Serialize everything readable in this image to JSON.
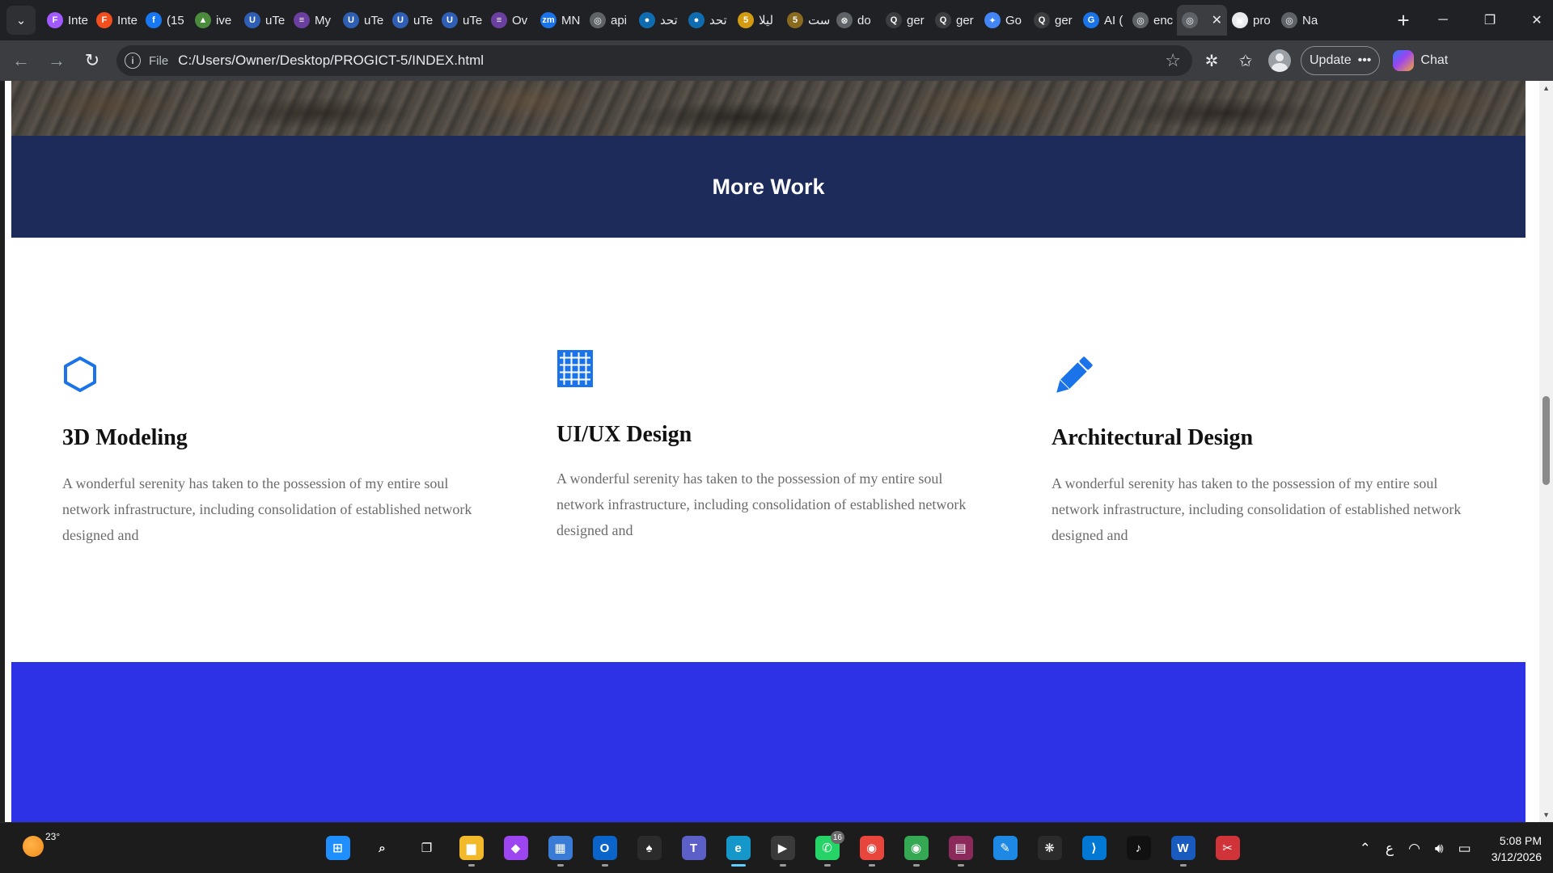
{
  "browser": {
    "tabs": [
      {
        "title": "Inte",
        "fav": "F",
        "color": "#a259ff"
      },
      {
        "title": "Inte",
        "fav": "F",
        "color": "#f24e1e"
      },
      {
        "title": "(15",
        "fav": "f",
        "color": "#1877f2"
      },
      {
        "title": "ive",
        "fav": "▲",
        "color": "#4a8b3c"
      },
      {
        "title": "uTe",
        "fav": "U",
        "color": "#2f5fb4"
      },
      {
        "title": "My",
        "fav": "≡",
        "color": "#6b3fa0"
      },
      {
        "title": "uTe",
        "fav": "U",
        "color": "#2f5fb4"
      },
      {
        "title": "uTe",
        "fav": "U",
        "color": "#2f5fb4"
      },
      {
        "title": "uTe",
        "fav": "U",
        "color": "#2f5fb4"
      },
      {
        "title": "Ov",
        "fav": "≡",
        "color": "#6b3fa0"
      },
      {
        "title": "MN",
        "fav": "zm",
        "color": "#1a73e8"
      },
      {
        "title": "api",
        "fav": "◎",
        "color": "#5f6368"
      },
      {
        "title": "تحد",
        "fav": "●",
        "color": "#0f6cb0"
      },
      {
        "title": "تحد",
        "fav": "●",
        "color": "#0f6cb0"
      },
      {
        "title": "ليلا",
        "fav": "5",
        "color": "#d29b12"
      },
      {
        "title": "است",
        "fav": "5",
        "color": "#8a6a1e"
      },
      {
        "title": "do",
        "fav": "⊗",
        "color": "#5f6368"
      },
      {
        "title": "ger",
        "fav": "Q",
        "color": "#3c3d40"
      },
      {
        "title": "ger",
        "fav": "Q",
        "color": "#3c3d40"
      },
      {
        "title": "Go",
        "fav": "✦",
        "color": "#4285f4"
      },
      {
        "title": "ger",
        "fav": "Q",
        "color": "#3c3d40"
      },
      {
        "title": "AI (",
        "fav": "G",
        "color": "#1a73e8"
      },
      {
        "title": "enc",
        "fav": "◎",
        "color": "#5f6368"
      },
      {
        "title": "",
        "fav": "◎",
        "color": "#5f6368",
        "active": true
      },
      {
        "title": "pro",
        "fav": "▣",
        "color": "#e8eaed"
      },
      {
        "title": "Na",
        "fav": "◎",
        "color": "#5f6368"
      }
    ],
    "omnibox": {
      "scheme": "File",
      "url": "C:/Users/Owner/Desktop/PROGICT-5/INDEX.html"
    },
    "update_label": "Update",
    "chat_label": "Chat"
  },
  "page": {
    "section_title": "More Work",
    "services": [
      {
        "title": "3D Modeling",
        "icon": "hexagon-icon",
        "text": "A wonderful serenity has taken to the possession of my entire soul network infrastructure, including consolidation of established network designed and"
      },
      {
        "title": "UI/UX Design",
        "icon": "grid-icon",
        "text": "A wonderful serenity has taken to the possession of my entire soul network infrastructure, including consolidation of established network designed and"
      },
      {
        "title": "Architectural Design",
        "icon": "pencil-icon",
        "text": "A wonderful serenity has taken to the possession of my entire soul network infrastructure, including consolidation of established network designed and"
      }
    ],
    "colors": {
      "header_band": "#1c2b5a",
      "accent_icon": "#1a73e8",
      "bottom_band": "#2d32e6"
    }
  },
  "taskbar": {
    "weather_temp": "23°",
    "apps": [
      {
        "name": "start",
        "glyph": "⊞",
        "color": "#1f8fff"
      },
      {
        "name": "search",
        "glyph": "⌕",
        "color": "transparent"
      },
      {
        "name": "task-view",
        "glyph": "❐",
        "color": "transparent"
      },
      {
        "name": "file-explorer",
        "glyph": "▆",
        "color": "#f2b92a"
      },
      {
        "name": "copilot",
        "glyph": "◆",
        "color": "#9c45f0"
      },
      {
        "name": "store",
        "glyph": "▦",
        "color": "#3a7bd5"
      },
      {
        "name": "outlook",
        "glyph": "O",
        "color": "#0a64c9"
      },
      {
        "name": "solitaire",
        "glyph": "♠",
        "color": "#2b2b2b"
      },
      {
        "name": "teams",
        "glyph": "T",
        "color": "#5b5fc7"
      },
      {
        "name": "edge",
        "glyph": "e",
        "color": "#1597c9"
      },
      {
        "name": "media-player",
        "glyph": "▶",
        "color": "#3a3a3a"
      },
      {
        "name": "whatsapp",
        "glyph": "✆",
        "color": "#25d366",
        "badge": "16"
      },
      {
        "name": "chrome-k",
        "glyph": "◉",
        "color": "#e8453c"
      },
      {
        "name": "chrome-m",
        "glyph": "◉",
        "color": "#34a853"
      },
      {
        "name": "winrar",
        "glyph": "▤",
        "color": "#8b2a5a"
      },
      {
        "name": "paint",
        "glyph": "✎",
        "color": "#1e88e5"
      },
      {
        "name": "chatgpt",
        "glyph": "❋",
        "color": "#2b2b2b"
      },
      {
        "name": "vscode",
        "glyph": "⟩",
        "color": "#0078d4"
      },
      {
        "name": "tiktok",
        "glyph": "♪",
        "color": "#111111"
      },
      {
        "name": "word",
        "glyph": "W",
        "color": "#185abd"
      },
      {
        "name": "snipping",
        "glyph": "✂",
        "color": "#d13438"
      }
    ],
    "tray_lang": "ع",
    "time": "5:08 PM",
    "date": "3/12/2026"
  }
}
